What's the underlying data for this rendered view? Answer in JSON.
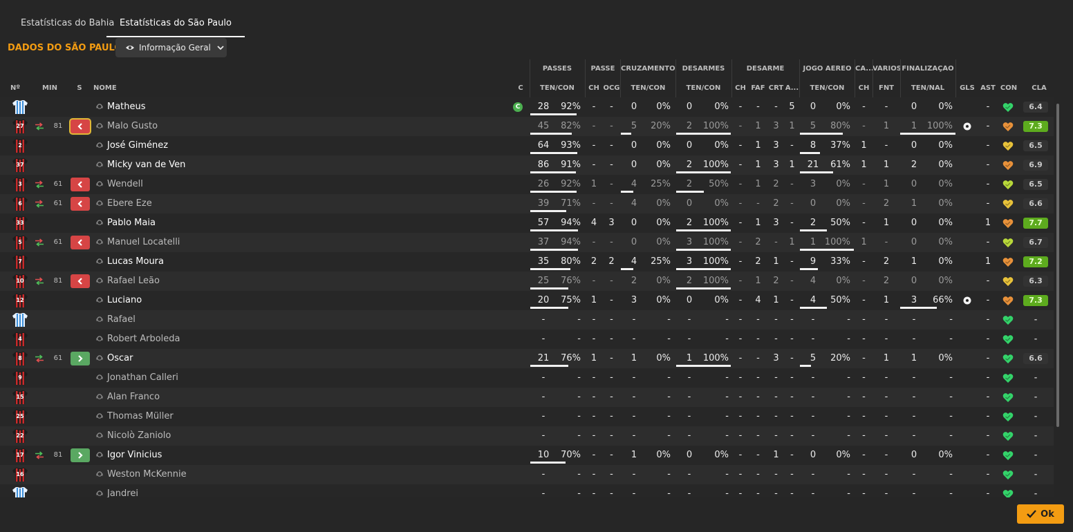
{
  "tabs": [
    {
      "label": "Estatísticas do Bahia",
      "active": false
    },
    {
      "label": "Estatísticas do São Paulo",
      "active": true
    }
  ],
  "section_title": "DADOS DO SÃO PAULO",
  "view_dropdown": {
    "label": "Informação Geral",
    "icon": "eye-icon"
  },
  "column_groups": [
    "PASSES",
    "PASSE",
    "CRUZAMENTOS",
    "DESARMES",
    "DESARME",
    "JOGO AÉREO",
    "CA...",
    "VÁRIOS",
    "FINALIZAÇÃO"
  ],
  "column_headers": [
    "Nº",
    "MIN",
    "S",
    "NOME",
    "C",
    "TEN/CON",
    "CH",
    "OCG",
    "TEN/CON",
    "TEN/CON",
    "CH",
    "FAF",
    "CRT",
    "A...",
    "TEN/CON",
    "CH",
    "FNT",
    "TEN/NAL",
    "GLS",
    "AST",
    "CON",
    "CLA"
  ],
  "players": [
    {
      "num": "",
      "kit": "gk",
      "min": "",
      "sub": "",
      "name": "Matheus",
      "captain": "C",
      "bench": false,
      "dim": false,
      "pass_att": "28",
      "pass_pct": "92%",
      "pass_bar": 0.92,
      "ch": "-",
      "ocg": "-",
      "cross_att": "0",
      "cross_pct": "0%",
      "cross_bar": 0,
      "tkl_att": "0",
      "tkl_pct": "0%",
      "tkl_bar": 0,
      "d_ch": "-",
      "faf": "-",
      "crt": "-",
      "a": "5",
      "air_att": "0",
      "air_pct": "0%",
      "air_bar": 0,
      "ca": "-",
      "fnt": "-",
      "sh_att": "0",
      "sh_pct": "0%",
      "sh_bar": 0,
      "gls": "",
      "ast": "-",
      "morale": "green",
      "rating": "6.4",
      "rating_class": "avg"
    },
    {
      "num": "27",
      "kit": "out",
      "min": "81",
      "sub": "out-hl",
      "name": "Malo Gusto",
      "captain": "",
      "bench": false,
      "dim": true,
      "pass_att": "45",
      "pass_pct": "82%",
      "pass_bar": 0.82,
      "ch": "-",
      "ocg": "-",
      "cross_att": "5",
      "cross_pct": "20%",
      "cross_bar": 0.2,
      "tkl_att": "2",
      "tkl_pct": "100%",
      "tkl_bar": 1,
      "d_ch": "-",
      "faf": "1",
      "crt": "3",
      "a": "1",
      "air_att": "5",
      "air_pct": "80%",
      "air_bar": 0.8,
      "ca": "-",
      "fnt": "1",
      "sh_att": "1",
      "sh_pct": "100%",
      "sh_bar": 1,
      "gls": "ball",
      "ast": "-",
      "morale": "orange",
      "rating": "7.3",
      "rating_class": "good"
    },
    {
      "num": "2",
      "kit": "out",
      "min": "",
      "sub": "",
      "name": "José Giménez",
      "captain": "",
      "bench": false,
      "dim": false,
      "pass_att": "64",
      "pass_pct": "93%",
      "pass_bar": 0.93,
      "ch": "-",
      "ocg": "-",
      "cross_att": "0",
      "cross_pct": "0%",
      "cross_bar": 0,
      "tkl_att": "0",
      "tkl_pct": "0%",
      "tkl_bar": 0,
      "d_ch": "-",
      "faf": "1",
      "crt": "3",
      "a": "-",
      "air_att": "8",
      "air_pct": "37%",
      "air_bar": 0.37,
      "ca": "1",
      "fnt": "-",
      "sh_att": "0",
      "sh_pct": "0%",
      "sh_bar": 0,
      "gls": "",
      "ast": "-",
      "morale": "yellow",
      "rating": "6.5",
      "rating_class": "avg"
    },
    {
      "num": "37",
      "kit": "out",
      "min": "",
      "sub": "",
      "name": "Micky van de Ven",
      "captain": "",
      "bench": false,
      "dim": false,
      "pass_att": "86",
      "pass_pct": "91%",
      "pass_bar": 0.91,
      "ch": "-",
      "ocg": "-",
      "cross_att": "0",
      "cross_pct": "0%",
      "cross_bar": 0,
      "tkl_att": "2",
      "tkl_pct": "100%",
      "tkl_bar": 1,
      "d_ch": "-",
      "faf": "1",
      "crt": "3",
      "a": "1",
      "air_att": "21",
      "air_pct": "61%",
      "air_bar": 0.61,
      "ca": "1",
      "fnt": "1",
      "sh_att": "2",
      "sh_pct": "0%",
      "sh_bar": 0,
      "gls": "",
      "ast": "-",
      "morale": "orange",
      "rating": "6.9",
      "rating_class": "avg"
    },
    {
      "num": "3",
      "kit": "out",
      "min": "61",
      "sub": "out",
      "name": "Wendell",
      "captain": "",
      "bench": false,
      "dim": true,
      "pass_att": "26",
      "pass_pct": "92%",
      "pass_bar": 0.92,
      "ch": "1",
      "ocg": "-",
      "cross_att": "4",
      "cross_pct": "25%",
      "cross_bar": 0.25,
      "tkl_att": "2",
      "tkl_pct": "50%",
      "tkl_bar": 0.5,
      "d_ch": "-",
      "faf": "1",
      "crt": "2",
      "a": "-",
      "air_att": "3",
      "air_pct": "0%",
      "air_bar": 0,
      "ca": "-",
      "fnt": "1",
      "sh_att": "0",
      "sh_pct": "0%",
      "sh_bar": 0,
      "gls": "",
      "ast": "-",
      "morale": "lime",
      "rating": "6.5",
      "rating_class": "avg"
    },
    {
      "num": "6",
      "kit": "out",
      "min": "61",
      "sub": "out",
      "name": "Ebere Eze",
      "captain": "",
      "bench": false,
      "dim": true,
      "pass_att": "39",
      "pass_pct": "71%",
      "pass_bar": 0.71,
      "ch": "-",
      "ocg": "-",
      "cross_att": "4",
      "cross_pct": "0%",
      "cross_bar": 0,
      "tkl_att": "0",
      "tkl_pct": "0%",
      "tkl_bar": 0,
      "d_ch": "-",
      "faf": "-",
      "crt": "2",
      "a": "-",
      "air_att": "0",
      "air_pct": "0%",
      "air_bar": 0,
      "ca": "-",
      "fnt": "2",
      "sh_att": "1",
      "sh_pct": "0%",
      "sh_bar": 0,
      "gls": "",
      "ast": "-",
      "morale": "yellow",
      "rating": "6.6",
      "rating_class": "avg"
    },
    {
      "num": "33",
      "kit": "out",
      "min": "",
      "sub": "",
      "name": "Pablo Maia",
      "captain": "",
      "bench": false,
      "dim": false,
      "pass_att": "57",
      "pass_pct": "94%",
      "pass_bar": 0.94,
      "ch": "4",
      "ocg": "3",
      "cross_att": "0",
      "cross_pct": "0%",
      "cross_bar": 0,
      "tkl_att": "2",
      "tkl_pct": "100%",
      "tkl_bar": 1,
      "d_ch": "-",
      "faf": "1",
      "crt": "3",
      "a": "-",
      "air_att": "2",
      "air_pct": "50%",
      "air_bar": 0.5,
      "ca": "-",
      "fnt": "1",
      "sh_att": "0",
      "sh_pct": "0%",
      "sh_bar": 0,
      "gls": "",
      "ast": "1",
      "morale": "orange",
      "rating": "7.7",
      "rating_class": "good"
    },
    {
      "num": "5",
      "kit": "out",
      "min": "61",
      "sub": "out",
      "name": "Manuel Locatelli",
      "captain": "",
      "bench": false,
      "dim": true,
      "pass_att": "37",
      "pass_pct": "94%",
      "pass_bar": 0.94,
      "ch": "-",
      "ocg": "-",
      "cross_att": "0",
      "cross_pct": "0%",
      "cross_bar": 0,
      "tkl_att": "3",
      "tkl_pct": "100%",
      "tkl_bar": 1,
      "d_ch": "-",
      "faf": "2",
      "crt": "-",
      "a": "1",
      "air_att": "1",
      "air_pct": "100%",
      "air_bar": 1,
      "ca": "1",
      "fnt": "-",
      "sh_att": "0",
      "sh_pct": "0%",
      "sh_bar": 0,
      "gls": "",
      "ast": "-",
      "morale": "lime",
      "rating": "6.7",
      "rating_class": "avg"
    },
    {
      "num": "7",
      "kit": "out",
      "min": "",
      "sub": "",
      "name": "Lucas Moura",
      "captain": "",
      "bench": false,
      "dim": false,
      "pass_att": "35",
      "pass_pct": "80%",
      "pass_bar": 0.8,
      "ch": "2",
      "ocg": "2",
      "cross_att": "4",
      "cross_pct": "25%",
      "cross_bar": 0.25,
      "tkl_att": "3",
      "tkl_pct": "100%",
      "tkl_bar": 1,
      "d_ch": "-",
      "faf": "2",
      "crt": "1",
      "a": "-",
      "air_att": "9",
      "air_pct": "33%",
      "air_bar": 0.33,
      "ca": "-",
      "fnt": "2",
      "sh_att": "1",
      "sh_pct": "0%",
      "sh_bar": 0,
      "gls": "",
      "ast": "1",
      "morale": "orange",
      "rating": "7.2",
      "rating_class": "good"
    },
    {
      "num": "10",
      "kit": "out",
      "min": "81",
      "sub": "out",
      "name": "Rafael Leão",
      "captain": "",
      "bench": false,
      "dim": true,
      "pass_att": "25",
      "pass_pct": "76%",
      "pass_bar": 0.76,
      "ch": "-",
      "ocg": "-",
      "cross_att": "2",
      "cross_pct": "0%",
      "cross_bar": 0,
      "tkl_att": "2",
      "tkl_pct": "100%",
      "tkl_bar": 1,
      "d_ch": "-",
      "faf": "1",
      "crt": "2",
      "a": "-",
      "air_att": "4",
      "air_pct": "0%",
      "air_bar": 0,
      "ca": "-",
      "fnt": "2",
      "sh_att": "0",
      "sh_pct": "0%",
      "sh_bar": 0,
      "gls": "",
      "ast": "-",
      "morale": "yellow",
      "rating": "6.3",
      "rating_class": "avg"
    },
    {
      "num": "12",
      "kit": "out",
      "min": "",
      "sub": "",
      "name": "Luciano",
      "captain": "",
      "bench": false,
      "dim": false,
      "pass_att": "20",
      "pass_pct": "75%",
      "pass_bar": 0.75,
      "ch": "1",
      "ocg": "-",
      "cross_att": "3",
      "cross_pct": "0%",
      "cross_bar": 0,
      "tkl_att": "0",
      "tkl_pct": "0%",
      "tkl_bar": 0,
      "d_ch": "-",
      "faf": "4",
      "crt": "1",
      "a": "-",
      "air_att": "4",
      "air_pct": "50%",
      "air_bar": 0.5,
      "ca": "-",
      "fnt": "1",
      "sh_att": "3",
      "sh_pct": "66%",
      "sh_bar": 0.66,
      "gls": "ball",
      "ast": "-",
      "morale": "orange",
      "rating": "7.3",
      "rating_class": "good"
    },
    {
      "num": "",
      "kit": "gk",
      "min": "",
      "sub": "",
      "name": "Rafael",
      "captain": "",
      "bench": true,
      "dim": false,
      "pass_att": "-",
      "pass_pct": "-",
      "pass_bar": 0,
      "ch": "-",
      "ocg": "-",
      "cross_att": "-",
      "cross_pct": "-",
      "cross_bar": 0,
      "tkl_att": "-",
      "tkl_pct": "-",
      "tkl_bar": 0,
      "d_ch": "-",
      "faf": "-",
      "crt": "-",
      "a": "-",
      "air_att": "-",
      "air_pct": "-",
      "air_bar": 0,
      "ca": "-",
      "fnt": "-",
      "sh_att": "-",
      "sh_pct": "-",
      "sh_bar": 0,
      "gls": "",
      "ast": "-",
      "morale": "green",
      "rating": "-",
      "rating_class": "none"
    },
    {
      "num": "4",
      "kit": "out",
      "min": "",
      "sub": "",
      "name": "Robert Arboleda",
      "captain": "",
      "bench": true,
      "dim": false,
      "pass_att": "-",
      "pass_pct": "-",
      "pass_bar": 0,
      "ch": "-",
      "ocg": "-",
      "cross_att": "-",
      "cross_pct": "-",
      "cross_bar": 0,
      "tkl_att": "-",
      "tkl_pct": "-",
      "tkl_bar": 0,
      "d_ch": "-",
      "faf": "-",
      "crt": "-",
      "a": "-",
      "air_att": "-",
      "air_pct": "-",
      "air_bar": 0,
      "ca": "-",
      "fnt": "-",
      "sh_att": "-",
      "sh_pct": "-",
      "sh_bar": 0,
      "gls": "",
      "ast": "-",
      "morale": "green",
      "rating": "-",
      "rating_class": "none"
    },
    {
      "num": "8",
      "kit": "out",
      "min": "61",
      "sub": "in",
      "name": "Oscar",
      "captain": "",
      "bench": false,
      "dim": false,
      "pass_att": "21",
      "pass_pct": "76%",
      "pass_bar": 0.76,
      "ch": "1",
      "ocg": "-",
      "cross_att": "1",
      "cross_pct": "0%",
      "cross_bar": 0,
      "tkl_att": "1",
      "tkl_pct": "100%",
      "tkl_bar": 1,
      "d_ch": "-",
      "faf": "-",
      "crt": "3",
      "a": "-",
      "air_att": "5",
      "air_pct": "20%",
      "air_bar": 0.2,
      "ca": "-",
      "fnt": "1",
      "sh_att": "1",
      "sh_pct": "0%",
      "sh_bar": 0,
      "gls": "",
      "ast": "-",
      "morale": "green",
      "rating": "6.6",
      "rating_class": "avg"
    },
    {
      "num": "9",
      "kit": "out",
      "min": "",
      "sub": "",
      "name": "Jonathan Calleri",
      "captain": "",
      "bench": true,
      "dim": false,
      "pass_att": "-",
      "pass_pct": "-",
      "pass_bar": 0,
      "ch": "-",
      "ocg": "-",
      "cross_att": "-",
      "cross_pct": "-",
      "cross_bar": 0,
      "tkl_att": "-",
      "tkl_pct": "-",
      "tkl_bar": 0,
      "d_ch": "-",
      "faf": "-",
      "crt": "-",
      "a": "-",
      "air_att": "-",
      "air_pct": "-",
      "air_bar": 0,
      "ca": "-",
      "fnt": "-",
      "sh_att": "-",
      "sh_pct": "-",
      "sh_bar": 0,
      "gls": "",
      "ast": "-",
      "morale": "green",
      "rating": "-",
      "rating_class": "none"
    },
    {
      "num": "15",
      "kit": "out",
      "min": "",
      "sub": "",
      "name": "Alan Franco",
      "captain": "",
      "bench": true,
      "dim": false,
      "pass_att": "-",
      "pass_pct": "-",
      "pass_bar": 0,
      "ch": "-",
      "ocg": "-",
      "cross_att": "-",
      "cross_pct": "-",
      "cross_bar": 0,
      "tkl_att": "-",
      "tkl_pct": "-",
      "tkl_bar": 0,
      "d_ch": "-",
      "faf": "-",
      "crt": "-",
      "a": "-",
      "air_att": "-",
      "air_pct": "-",
      "air_bar": 0,
      "ca": "-",
      "fnt": "-",
      "sh_att": "-",
      "sh_pct": "-",
      "sh_bar": 0,
      "gls": "",
      "ast": "-",
      "morale": "green",
      "rating": "-",
      "rating_class": "none"
    },
    {
      "num": "25",
      "kit": "out",
      "min": "",
      "sub": "",
      "name": "Thomas Müller",
      "captain": "",
      "bench": true,
      "dim": false,
      "pass_att": "-",
      "pass_pct": "-",
      "pass_bar": 0,
      "ch": "-",
      "ocg": "-",
      "cross_att": "-",
      "cross_pct": "-",
      "cross_bar": 0,
      "tkl_att": "-",
      "tkl_pct": "-",
      "tkl_bar": 0,
      "d_ch": "-",
      "faf": "-",
      "crt": "-",
      "a": "-",
      "air_att": "-",
      "air_pct": "-",
      "air_bar": 0,
      "ca": "-",
      "fnt": "-",
      "sh_att": "-",
      "sh_pct": "-",
      "sh_bar": 0,
      "gls": "",
      "ast": "-",
      "morale": "green",
      "rating": "-",
      "rating_class": "none"
    },
    {
      "num": "22",
      "kit": "out",
      "min": "",
      "sub": "",
      "name": "Nicolò Zaniolo",
      "captain": "",
      "bench": true,
      "dim": false,
      "pass_att": "-",
      "pass_pct": "-",
      "pass_bar": 0,
      "ch": "-",
      "ocg": "-",
      "cross_att": "-",
      "cross_pct": "-",
      "cross_bar": 0,
      "tkl_att": "-",
      "tkl_pct": "-",
      "tkl_bar": 0,
      "d_ch": "-",
      "faf": "-",
      "crt": "-",
      "a": "-",
      "air_att": "-",
      "air_pct": "-",
      "air_bar": 0,
      "ca": "-",
      "fnt": "-",
      "sh_att": "-",
      "sh_pct": "-",
      "sh_bar": 0,
      "gls": "",
      "ast": "-",
      "morale": "green",
      "rating": "-",
      "rating_class": "none"
    },
    {
      "num": "17",
      "kit": "out",
      "min": "81",
      "sub": "in",
      "name": "Igor Vinicius",
      "captain": "",
      "bench": false,
      "dim": false,
      "pass_att": "10",
      "pass_pct": "70%",
      "pass_bar": 0.7,
      "ch": "-",
      "ocg": "-",
      "cross_att": "1",
      "cross_pct": "0%",
      "cross_bar": 0,
      "tkl_att": "0",
      "tkl_pct": "0%",
      "tkl_bar": 0,
      "d_ch": "-",
      "faf": "-",
      "crt": "1",
      "a": "-",
      "air_att": "0",
      "air_pct": "0%",
      "air_bar": 0,
      "ca": "-",
      "fnt": "-",
      "sh_att": "0",
      "sh_pct": "0%",
      "sh_bar": 0,
      "gls": "",
      "ast": "-",
      "morale": "green",
      "rating": "-",
      "rating_class": "none"
    },
    {
      "num": "16",
      "kit": "out",
      "min": "",
      "sub": "",
      "name": "Weston McKennie",
      "captain": "",
      "bench": true,
      "dim": false,
      "pass_att": "-",
      "pass_pct": "-",
      "pass_bar": 0,
      "ch": "-",
      "ocg": "-",
      "cross_att": "-",
      "cross_pct": "-",
      "cross_bar": 0,
      "tkl_att": "-",
      "tkl_pct": "-",
      "tkl_bar": 0,
      "d_ch": "-",
      "faf": "-",
      "crt": "-",
      "a": "-",
      "air_att": "-",
      "air_pct": "-",
      "air_bar": 0,
      "ca": "-",
      "fnt": "-",
      "sh_att": "-",
      "sh_pct": "-",
      "sh_bar": 0,
      "gls": "",
      "ast": "-",
      "morale": "green",
      "rating": "-",
      "rating_class": "none"
    },
    {
      "num": "",
      "kit": "gk",
      "min": "",
      "sub": "",
      "name": "Jandrei",
      "captain": "",
      "bench": true,
      "dim": false,
      "pass_att": "-",
      "pass_pct": "-",
      "pass_bar": 0,
      "ch": "-",
      "ocg": "-",
      "cross_att": "-",
      "cross_pct": "-",
      "cross_bar": 0,
      "tkl_att": "-",
      "tkl_pct": "-",
      "tkl_bar": 0,
      "d_ch": "-",
      "faf": "-",
      "crt": "-",
      "a": "-",
      "air_att": "-",
      "air_pct": "-",
      "air_bar": 0,
      "ca": "-",
      "fnt": "-",
      "sh_att": "-",
      "sh_pct": "-",
      "sh_bar": 0,
      "gls": "",
      "ast": "-",
      "morale": "green",
      "rating": "-",
      "rating_class": "none"
    }
  ],
  "ok_button": "Ok",
  "colors": {
    "accent": "#f39c12",
    "sub_out": "#d64545",
    "sub_in": "#5aa862",
    "rating_good": "#5dab1e",
    "background": "#262626"
  }
}
